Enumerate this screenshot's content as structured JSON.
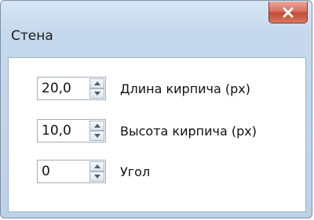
{
  "window": {
    "title": "Стена",
    "close_icon": "close-icon"
  },
  "fields": [
    {
      "value": "20,0",
      "label": "Длина кирпича (px)"
    },
    {
      "value": "10,0",
      "label": "Высота кирпича (px)"
    },
    {
      "value": "0",
      "label": "Угол"
    }
  ],
  "colors": {
    "frame": "#c6d9ec",
    "close_button": "#d9705f"
  }
}
